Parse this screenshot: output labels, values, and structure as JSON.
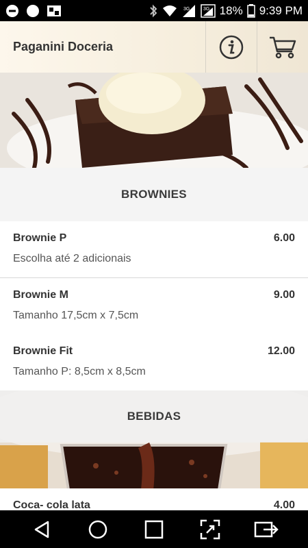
{
  "status_bar": {
    "network_3g_a": "3G",
    "network_3g_b": "3G",
    "battery": "18%",
    "time": "9:39 PM"
  },
  "header": {
    "title": "Paganini Doceria",
    "info_icon": "info-icon",
    "cart_icon": "cart-icon"
  },
  "sections": [
    {
      "title": "BROWNIES",
      "items": [
        {
          "name": "Brownie P",
          "price": "6.00",
          "description": "Escolha até 2 adicionais"
        },
        {
          "name": "Brownie M",
          "price": "9.00",
          "description": "Tamanho 17,5cm x 7,5cm"
        },
        {
          "name": "Brownie Fit",
          "price": "12.00",
          "description": "Tamanho P: 8,5cm x 8,5cm"
        }
      ]
    },
    {
      "title": "BEBIDAS",
      "items": [
        {
          "name": "Coca- cola lata",
          "price": "4.00"
        }
      ]
    }
  ],
  "nav": {
    "back": "back-icon",
    "home": "home-icon",
    "recents": "recents-icon",
    "screenshot": "expand-icon",
    "cast": "cast-icon"
  }
}
